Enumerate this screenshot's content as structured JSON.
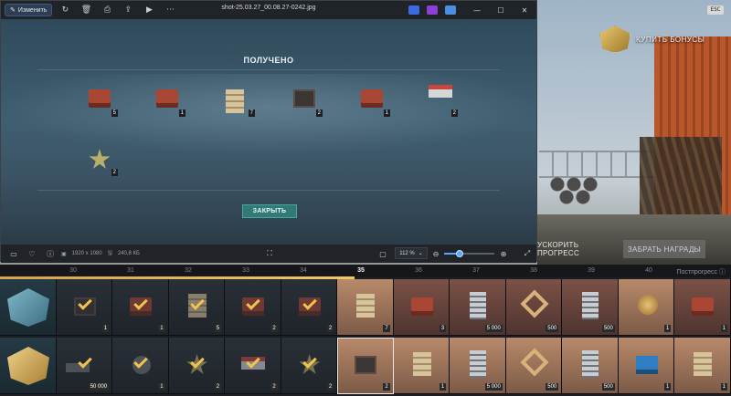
{
  "viewer": {
    "file_name": "shot-25.03.27_00.08.27-0242.jpg",
    "edit_label": "Изменить",
    "toolbar_icons": [
      "rotate-icon",
      "delete-icon",
      "print-icon",
      "share-icon",
      "slideshow-icon",
      "more-icon"
    ],
    "app_icons": [
      {
        "name": "app-icon-blue",
        "color": "#3b6be0"
      },
      {
        "name": "app-icon-purple",
        "color": "#8b3fd8"
      },
      {
        "name": "app-icon-cloud",
        "color": "#4b8fe0"
      }
    ],
    "window_buttons": [
      "—",
      "☐",
      "✕"
    ],
    "dialog": {
      "title": "ПОЛУЧЕНО",
      "close_label": "ЗАКРЫТЬ",
      "rewards": [
        {
          "type": "truck",
          "count": "5"
        },
        {
          "type": "truck",
          "count": "1"
        },
        {
          "type": "building",
          "count": "7"
        },
        {
          "type": "box-dark",
          "count": "2"
        },
        {
          "type": "crate",
          "count": "1"
        },
        {
          "type": "flag-star",
          "count": "2"
        },
        {
          "type": "star",
          "count": "2"
        }
      ]
    },
    "status": {
      "resolution": "1920 x 1080",
      "file_size": "240,8 КБ",
      "zoom": "112 %",
      "zoom_fraction": 0.3
    }
  },
  "game": {
    "buy_bonus_label": "КУПИТЬ БОНУСЫ",
    "esc_label": "ESC",
    "speed_up_label": "УСКОРИТЬ ПРОГРЕСС",
    "claim_label": "ЗАБРАТЬ НАГРАДЫ",
    "post_progress_label": "Постпрогресс ⓘ",
    "levels": [
      "30",
      "31",
      "32",
      "33",
      "34",
      "35",
      "36",
      "37",
      "38",
      "39",
      "40"
    ],
    "current_level": "35",
    "progress_fraction": 0.485,
    "row1": [
      {
        "type": "emblem-blue",
        "count": ""
      },
      {
        "type": "selected-check",
        "count": "1",
        "done": true
      },
      {
        "type": "truck",
        "count": "1",
        "done": true
      },
      {
        "type": "building",
        "count": "5",
        "done": true
      },
      {
        "type": "truck",
        "count": "2",
        "done": true
      },
      {
        "type": "truck",
        "count": "2",
        "done": true
      },
      {
        "type": "building",
        "count": "7",
        "state": "active"
      },
      {
        "type": "truck",
        "count": "3",
        "state": "locked"
      },
      {
        "type": "tower",
        "count": "5 000",
        "state": "locked"
      },
      {
        "type": "frame-s",
        "count": "500",
        "state": "locked"
      },
      {
        "type": "tower",
        "count": "500",
        "state": "locked"
      },
      {
        "type": "medal",
        "count": "1",
        "state": "active"
      },
      {
        "type": "truck",
        "count": "1",
        "state": "locked"
      }
    ],
    "row2": [
      {
        "type": "emblem-gold",
        "count": ""
      },
      {
        "type": "note",
        "count": "50 000",
        "done": true
      },
      {
        "type": "coin",
        "count": "1",
        "done": true
      },
      {
        "type": "star",
        "count": "2",
        "done": true
      },
      {
        "type": "plate",
        "count": "2",
        "done": true
      },
      {
        "type": "star",
        "count": "2",
        "done": true
      },
      {
        "type": "box-dark",
        "count": "2",
        "state": "selected"
      },
      {
        "type": "building",
        "count": "1",
        "state": "active"
      },
      {
        "type": "tower",
        "count": "5 000",
        "state": "active"
      },
      {
        "type": "frame-s",
        "count": "500",
        "state": "active"
      },
      {
        "type": "tower",
        "count": "500",
        "state": "active"
      },
      {
        "type": "crate-blue",
        "count": "1",
        "state": "active"
      },
      {
        "type": "building",
        "count": "1",
        "state": "active"
      }
    ]
  }
}
